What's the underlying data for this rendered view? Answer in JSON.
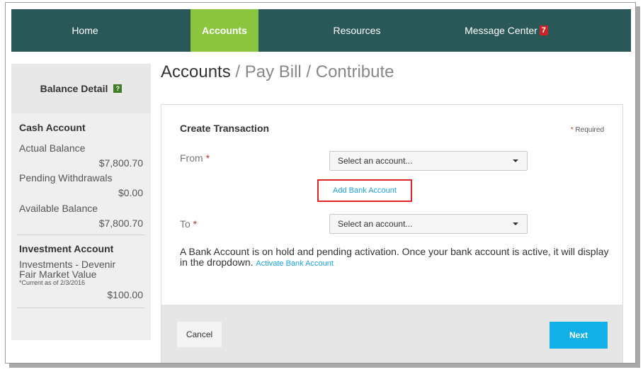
{
  "nav": {
    "items": [
      {
        "label": "Home"
      },
      {
        "label": "Accounts"
      },
      {
        "label": "Resources"
      },
      {
        "label": "Message Center",
        "badge": "7"
      }
    ]
  },
  "sidebar": {
    "title": "Balance Detail",
    "help_glyph": "?",
    "cash": {
      "heading": "Cash Account",
      "actual_label": "Actual Balance",
      "actual_value": "$7,800.70",
      "pending_label": "Pending Withdrawals",
      "pending_value": "$0.00",
      "available_label": "Available Balance",
      "available_value": "$7,800.70"
    },
    "investment": {
      "heading": "Investment Account",
      "name_line1": "Investments - Devenir",
      "name_line2": "Fair Market Value",
      "as_of": "*Current as of 2/3/2016",
      "value": "$100.00"
    }
  },
  "page": {
    "title_main": "Accounts",
    "title_rest": " / Pay Bill / Contribute"
  },
  "form": {
    "title": "Create Transaction",
    "required_star": "*",
    "required_note": " Required",
    "from_label": "From",
    "from_placeholder": "Select an account...",
    "add_bank_link": "Add Bank Account",
    "to_label": "To",
    "to_placeholder": "Select an account...",
    "info_text": "A Bank Account is on hold and pending activation. Once your bank account is active, it will display in the dropdown.",
    "activate_link": "Activate Bank Account",
    "cancel_label": "Cancel",
    "next_label": "Next"
  },
  "colors": {
    "nav_bg": "#2a5858",
    "nav_active": "#8bc53f",
    "badge": "#c8262a",
    "link": "#1aa3d9",
    "highlight_box": "#e0242b",
    "primary_button": "#11b0e6"
  }
}
